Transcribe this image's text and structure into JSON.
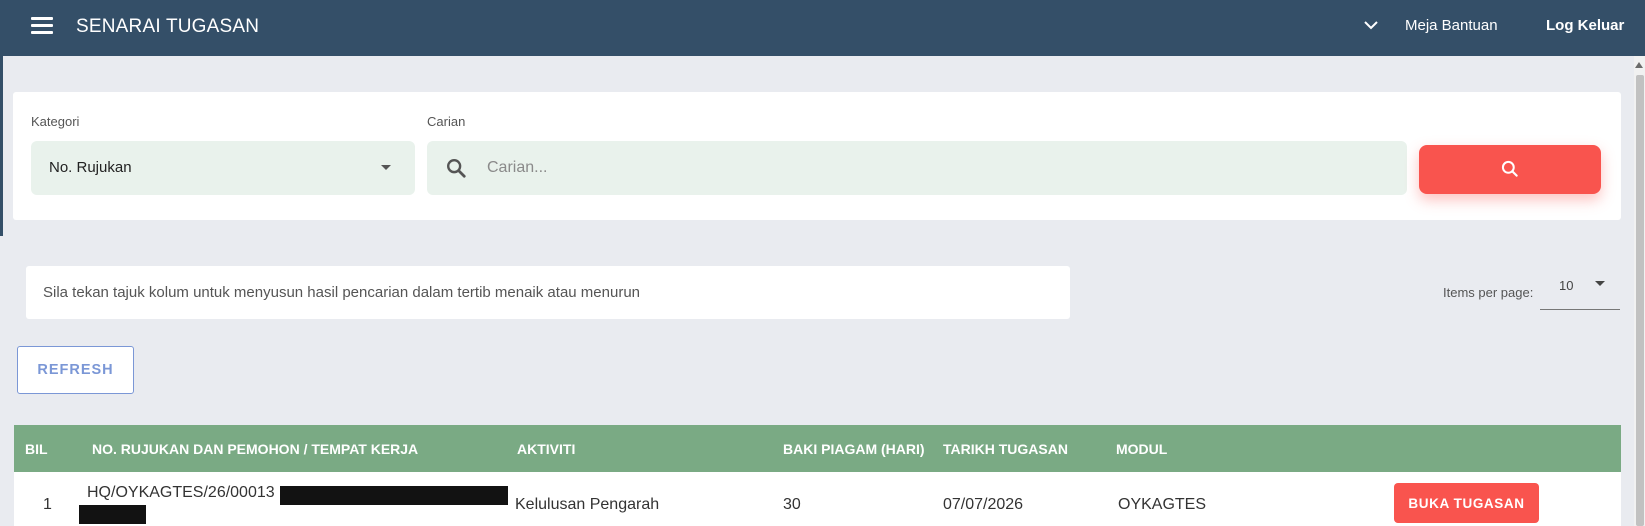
{
  "header": {
    "title": "SENARAI TUGASAN",
    "help_label": "Meja Bantuan",
    "logout_label": "Log Keluar"
  },
  "filter": {
    "category_label": "Kategori",
    "category_value": "No. Rujukan",
    "search_label": "Carian",
    "search_placeholder": "Carian...",
    "search_value": ""
  },
  "info": {
    "sort_hint": "Sila tekan tajuk kolum untuk menyusun hasil pencarian dalam tertib menaik atau menurun"
  },
  "pagination": {
    "items_per_page_label": "Items per page:",
    "items_per_page_value": "10"
  },
  "actions": {
    "refresh_label": "REFRESH"
  },
  "table": {
    "columns": [
      "BIL",
      "NO. RUJUKAN DAN PEMOHON / TEMPAT KERJA",
      "AKTIVITI",
      "BAKI PIAGAM (HARI)",
      "TARIKH TUGASAN",
      "MODUL"
    ],
    "rows": [
      {
        "bil": "1",
        "reference": "HQ/OYKAGTES/26/00013",
        "activity": "Kelulusan Pengarah",
        "charter_balance": "30",
        "task_date": "07/07/2026",
        "module": "OYKAGTES",
        "action_label": "BUKA TUGASAN"
      }
    ]
  },
  "colors": {
    "topbar": "#344f68",
    "accent_red": "#f9544e",
    "table_header": "#7aaa84",
    "input_bg": "#e9f2ec",
    "refresh_blue": "#7b97d6"
  }
}
